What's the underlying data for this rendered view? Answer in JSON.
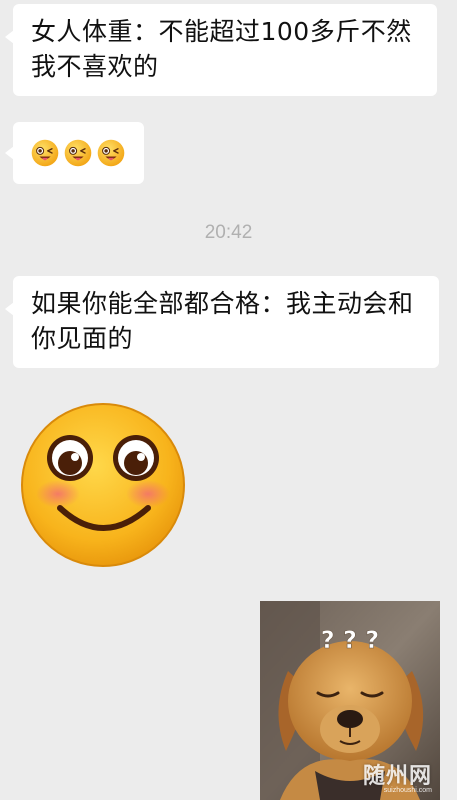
{
  "messages": [
    {
      "text": "女人体重：不能超过100多斤不然\n我不喜欢的"
    },
    {
      "emojis": [
        "tongue-wink-emoji",
        "tongue-wink-emoji",
        "tongue-wink-emoji"
      ]
    },
    {
      "text": "如果你能全部都合格：我主动会和\n你见面的"
    }
  ],
  "timestamp": "20:42",
  "sticker": {
    "icon": "blushing-smile-emoji"
  },
  "photo": {
    "caption_marks": "? ? ?",
    "watermark": "随州网",
    "watermark_sub": "suizhoushi.com"
  },
  "colors": {
    "background": "#ececec",
    "bubble": "#ffffff",
    "emoji_yellow": "#f7b21a",
    "timestamp": "#b0b0b0"
  }
}
